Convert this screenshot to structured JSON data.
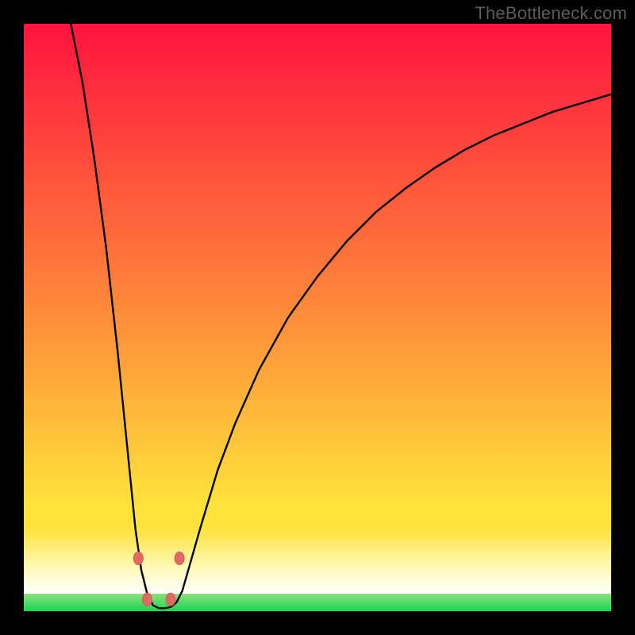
{
  "watermark": {
    "text": "TheBottleneck.com"
  },
  "colors": {
    "frame_bg_black": "#000000",
    "gradient_top": "#ff133f",
    "gradient_mid_orange": "#ff813a",
    "gradient_yellow": "#ffe23a",
    "pale_yellow": "#fff9b8",
    "green_top": "#8de27a",
    "green_bottom": "#18d454",
    "curve_stroke": "#000000",
    "marker_fill": "#e06a63",
    "marker_stroke": "#d85a52",
    "watermark_text": "#5c5c5c"
  },
  "chart_data": {
    "type": "line",
    "title": "",
    "xlabel": "",
    "ylabel": "",
    "xlim": [
      0,
      100
    ],
    "ylim": [
      0,
      100
    ],
    "series": [
      {
        "name": "bottleneck-curve",
        "x": [
          8,
          10,
          12,
          14,
          16,
          17,
          18,
          19,
          20,
          21,
          22,
          23,
          24,
          25,
          26,
          27,
          28,
          30,
          33,
          36,
          40,
          45,
          50,
          55,
          60,
          65,
          70,
          75,
          80,
          85,
          90,
          95,
          100
        ],
        "y": [
          100,
          90,
          77,
          62,
          44,
          34,
          24,
          14,
          7,
          3,
          1,
          0.5,
          0.5,
          0.7,
          1.5,
          3.5,
          7,
          14,
          24,
          32,
          41,
          50,
          57,
          63,
          68,
          72,
          75.5,
          78.5,
          81,
          83,
          85,
          86.5,
          88
        ]
      }
    ],
    "markers": {
      "name": "highlight-dots",
      "points": [
        {
          "x": 19.5,
          "y": 9
        },
        {
          "x": 26.5,
          "y": 9
        },
        {
          "x": 21.0,
          "y": 2
        },
        {
          "x": 25.0,
          "y": 2
        }
      ],
      "rx": 6,
      "ry": 8
    },
    "bands": {
      "pale_yellow": {
        "y0": 14,
        "y1": 3
      },
      "green": {
        "y0": 3,
        "y1": 0
      }
    }
  }
}
